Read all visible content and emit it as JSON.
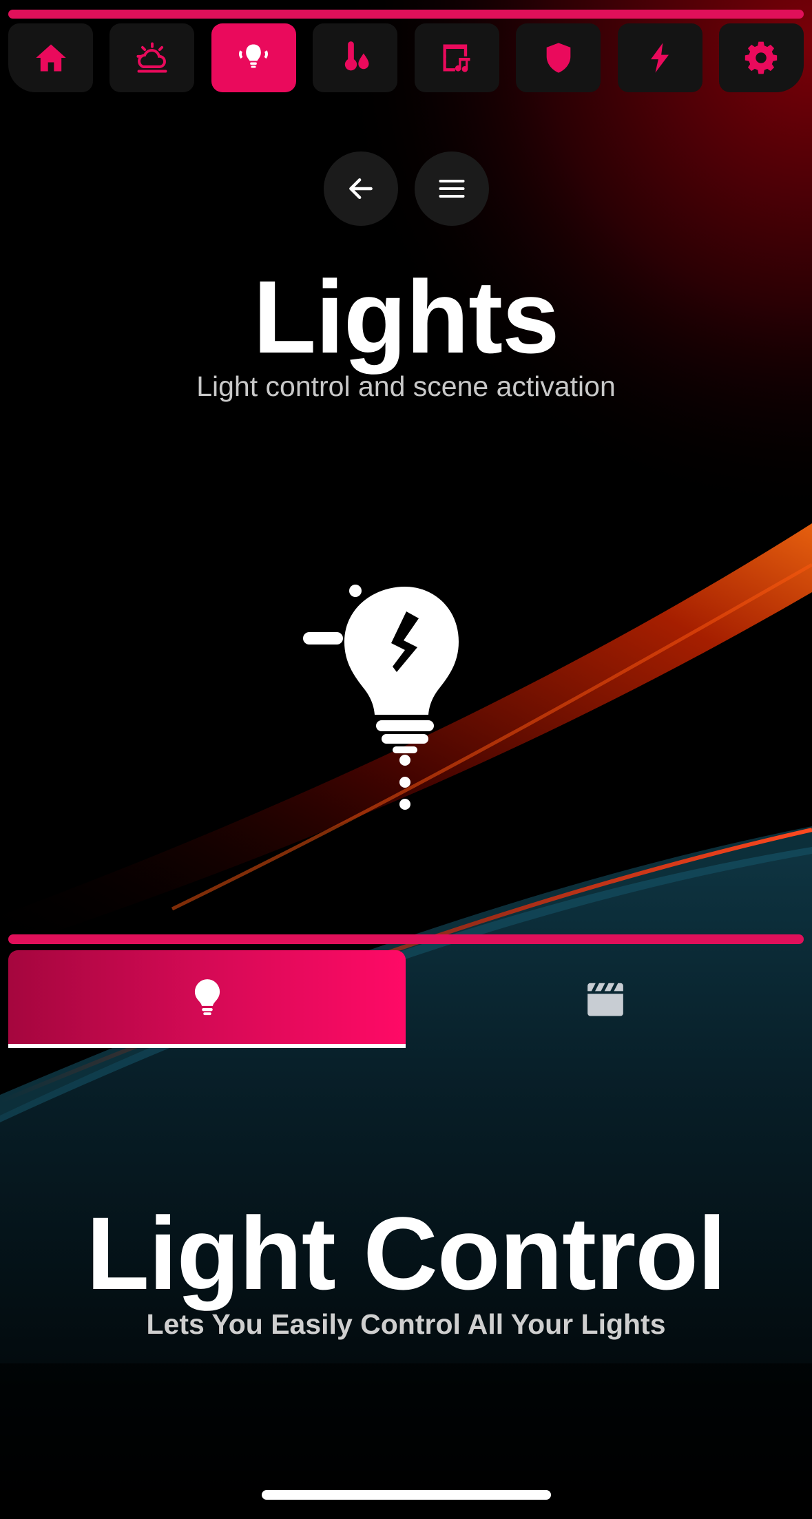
{
  "colors": {
    "accent": "#ea0a5c",
    "accent_line": "#e0105a",
    "nav_button_bg": "#141414",
    "round_button_bg": "#1b1b1b",
    "subtitle_text": "#c9c9c9",
    "inactive_icon": "#c8cdd3"
  },
  "top_nav": {
    "items": [
      {
        "icon": "home-icon",
        "active": false
      },
      {
        "icon": "weather-sun-cloud-icon",
        "active": false
      },
      {
        "icon": "ceiling-lights-icon",
        "active": true
      },
      {
        "icon": "thermometer-water-icon",
        "active": false
      },
      {
        "icon": "media-room-icon",
        "active": false
      },
      {
        "icon": "shield-icon",
        "active": false
      },
      {
        "icon": "lightning-bolt-icon",
        "active": false
      },
      {
        "icon": "gear-icon",
        "active": false
      }
    ]
  },
  "header": {
    "back_icon": "arrow-left-icon",
    "menu_icon": "hamburger-menu-icon",
    "title": "Lights",
    "subtitle": "Light control and scene activation",
    "hero_icon": "lightbulb-bolt-icon"
  },
  "tabs": [
    {
      "icon": "lightbulb-icon",
      "active": true
    },
    {
      "icon": "clapperboard-icon",
      "active": false
    }
  ],
  "section": {
    "title": "Light Control",
    "subtitle": "Lets You Easily Control All Your Lights"
  }
}
